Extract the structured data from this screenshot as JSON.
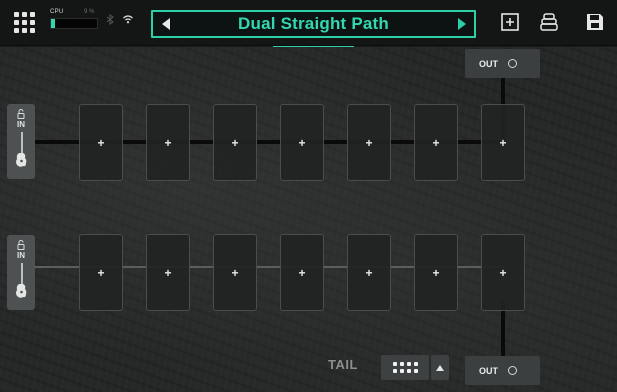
{
  "topbar": {
    "cpu_label": "CPU",
    "cpu_percent": "9 %",
    "cpu_fill": 0.09,
    "preset_name": "Dual Straight Path",
    "icons": {
      "menu": "grid-menu-icon",
      "bluetooth": "bluetooth-icon",
      "wifi": "wifi-icon",
      "prev": "triangle-left-icon",
      "next": "triangle-right-icon",
      "add_block": "plus-square-icon",
      "tuner": "stack-icon",
      "save": "floppy-disk-icon"
    }
  },
  "rows": [
    {
      "input_label": "IN",
      "slots": [
        "+",
        "+",
        "+",
        "+",
        "+",
        "+",
        "+"
      ]
    },
    {
      "input_label": "IN",
      "slots": [
        "+",
        "+",
        "+",
        "+",
        "+",
        "+",
        "+"
      ]
    }
  ],
  "outputs": [
    {
      "label": "OUT"
    },
    {
      "label": "OUT"
    }
  ],
  "tail": {
    "label": "TAIL"
  },
  "colors": {
    "accent": "#2ccfa6",
    "background": "#262727",
    "slot": "#222323"
  }
}
